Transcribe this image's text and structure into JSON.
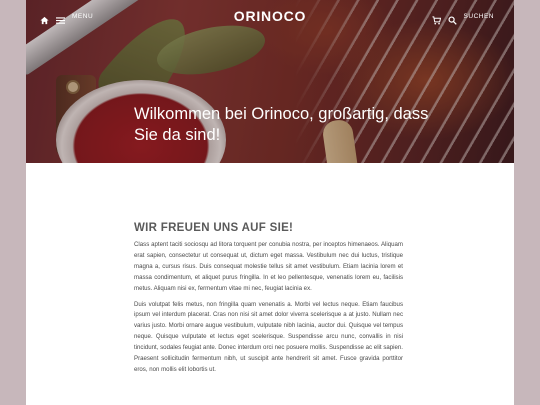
{
  "header": {
    "logo": "ORINOCO",
    "menu_label": "MENU",
    "search_label": "SUCHEN",
    "icons": [
      "home-icon",
      "menu-icon",
      "cart-icon",
      "search-icon"
    ]
  },
  "hero": {
    "title": "Wilkommen bei Orinoco, großartig, dass Sie da sind!"
  },
  "main": {
    "heading": "WIR FREUEN UNS AUF SIE!",
    "paragraphs": [
      "Class aptent taciti sociosqu ad litora torquent per conubia nostra, per inceptos himenaeos. Aliquam erat sapien, consectetur ut consequat ut, dictum eget massa. Vestibulum nec dui luctus, tristique magna a, cursus risus. Duis consequat molestie tellus sit amet vestibulum. Etiam lacinia lorem et massa condimentum, et aliquet purus fringilla. In et leo pellentesque, venenatis lorem eu, facilisis metus. Aliquam nisi ex, fermentum vitae mi nec, feugiat lacinia ex.",
      "Duis volutpat felis metus, non fringilla quam venenatis a. Morbi vel lectus neque. Etiam faucibus ipsum vel interdum placerat. Cras non nisi sit amet dolor viverra scelerisque a at justo. Nullam nec varius justo. Morbi ornare augue vestibulum, vulputate nibh lacinia, auctor dui. Quisque vel tempus neque. Quisque vulputate et lectus eget scelerisque. Suspendisse arcu nunc, convallis in nisi tincidunt, sodales feugiat ante. Donec interdum orci nec posuere mollis. Suspendisse ac elit sapien. Praesent sollicitudin fermentum nibh, ut suscipit ante hendrerit sit amet. Fusce gravida porttitor eros, non mollis elit lobortis ut."
    ]
  },
  "colors": {
    "page_background": "#c7b7bb",
    "content_background": "#ffffff",
    "text": "#4a4a4a"
  }
}
